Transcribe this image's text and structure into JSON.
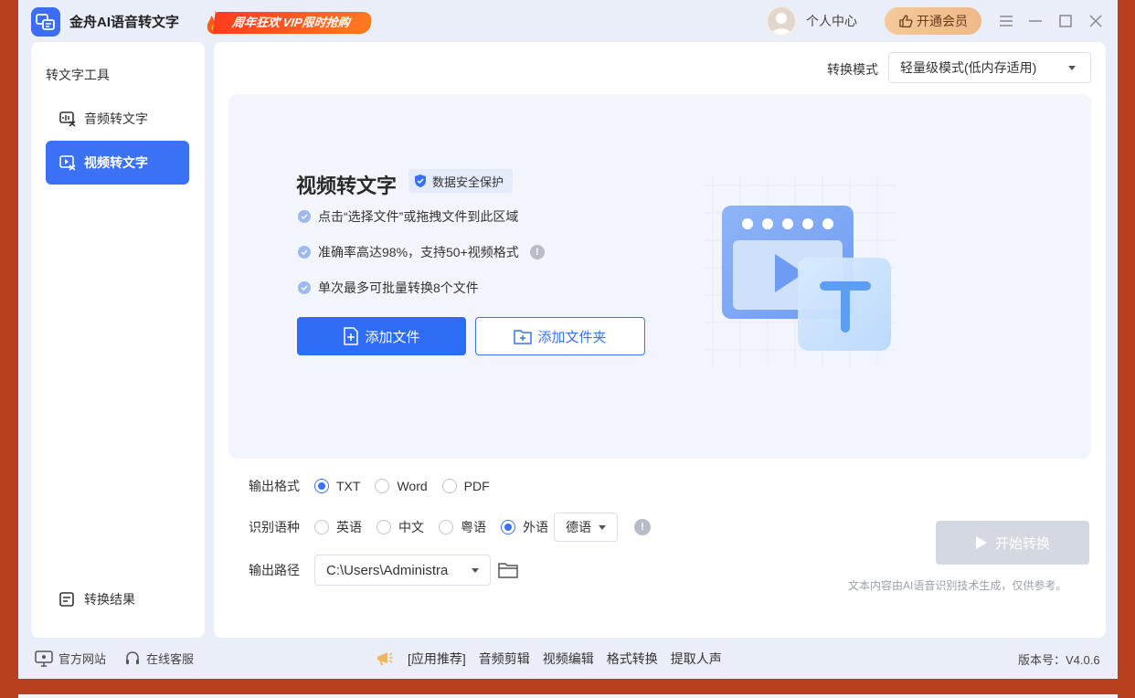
{
  "app": {
    "title": "金舟AI语音转文字"
  },
  "promo": {
    "text": "周年狂欢 VIP限时抢购"
  },
  "user": {
    "label": "个人中心",
    "vip_button": "开通会员"
  },
  "sidebar": {
    "heading": "转文字工具",
    "items": [
      {
        "label": "音频转文字",
        "icon": "audio-text-icon",
        "active": false
      },
      {
        "label": "视频转文字",
        "icon": "video-text-icon",
        "active": true
      }
    ],
    "result": "转换结果"
  },
  "main": {
    "mode_label": "转换模式",
    "mode_value": "轻量级模式(低内存适用)",
    "title": "视频转文字",
    "badge": "数据安全保护",
    "features": [
      "点击“选择文件”或拖拽文件到此区域",
      "准确率高达98%，支持50+视频格式",
      "单次最多可批量转换8个文件"
    ],
    "add_file": "添加文件",
    "add_folder": "添加文件夹",
    "output_format": {
      "label": "输出格式",
      "options": [
        "TXT",
        "Word",
        "PDF"
      ],
      "selected": "TXT"
    },
    "language": {
      "label": "识别语种",
      "options": [
        "英语",
        "中文",
        "粤语",
        "外语"
      ],
      "selected": "外语",
      "foreign_value": "德语"
    },
    "output_path": {
      "label": "输出路径",
      "value": "C:\\Users\\Administra"
    },
    "start": "开始转换",
    "disclaimer": "文本内容由AI语音识别技术生成，仅供参考。"
  },
  "footer": {
    "website": "官方网站",
    "service": "在线客服",
    "recommend": "[应用推荐]",
    "links": [
      "音频剪辑",
      "视频编辑",
      "格式转换",
      "提取人声"
    ],
    "version": "版本号：V4.0.6"
  },
  "colors": {
    "accent": "#2e6cf6",
    "frame": "#b8401f",
    "vip": "#f4c99a",
    "disabled": "#d4d8e0"
  }
}
